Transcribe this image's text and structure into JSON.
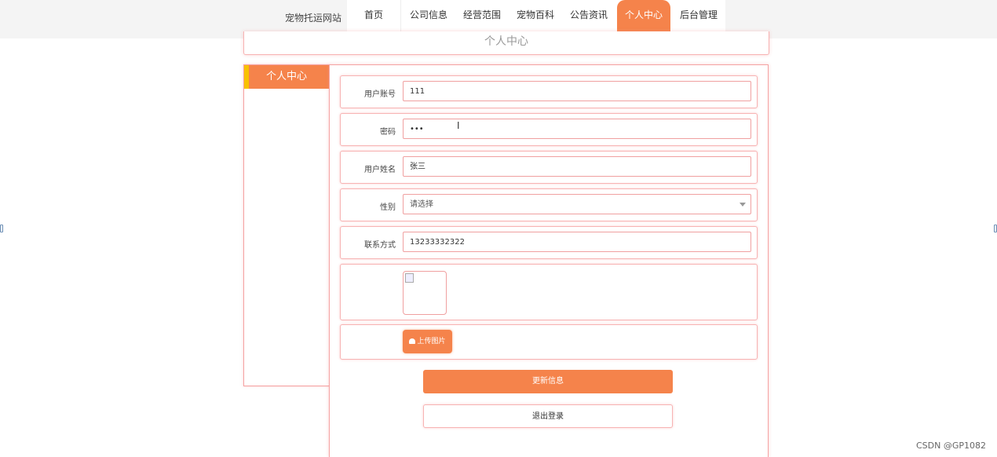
{
  "site": {
    "brand": "宠物托运网站"
  },
  "nav": {
    "items": [
      {
        "label": "首页",
        "active": false
      },
      {
        "label": "公司信息",
        "active": false
      },
      {
        "label": "经营范围",
        "active": false
      },
      {
        "label": "宠物百科",
        "active": false
      },
      {
        "label": "公告资讯",
        "active": false
      },
      {
        "label": "个人中心",
        "active": true
      },
      {
        "label": "后台管理",
        "active": false
      }
    ]
  },
  "page_title": "个人中心",
  "sidebar": {
    "heading": "个人中心"
  },
  "form": {
    "account": {
      "label": "用户账号",
      "value": "111"
    },
    "password": {
      "label": "密码",
      "value": "•••"
    },
    "name": {
      "label": "用户姓名",
      "value": "张三"
    },
    "gender": {
      "label": "性别",
      "value": "请选择"
    },
    "contact": {
      "label": "联系方式",
      "value": "13233332322"
    },
    "upload_label": "上传图片",
    "update_label": "更新信息",
    "logout_label": "退出登录"
  },
  "watermark": "CSDN @GP1082",
  "colors": {
    "accent": "#f5834b",
    "highlight": "#f8c200",
    "border": "#f5a3a3"
  }
}
